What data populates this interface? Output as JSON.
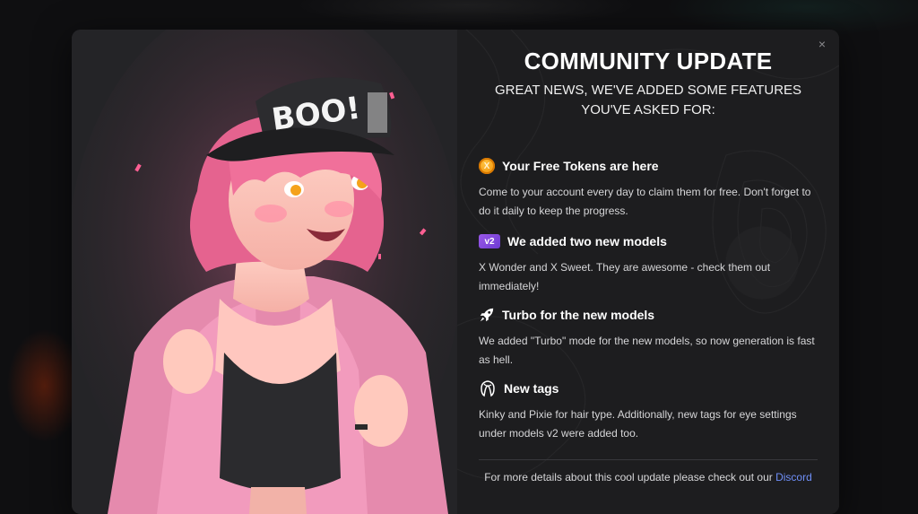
{
  "modal": {
    "title": "COMMUNITY UPDATE",
    "subtitle": "GREAT NEWS, WE'VE ADDED SOME FEATURES YOU'VE ASKED FOR:",
    "close_glyph": "×",
    "art_cap_text": "BOO!"
  },
  "features": [
    {
      "icon": "token-coin-icon",
      "icon_text": "X",
      "title": "Your Free Tokens are here",
      "description": "Come to your account every day to claim them for free. Don't forget to do it daily to keep the progress."
    },
    {
      "icon": "v2-badge-icon",
      "icon_text": "v2",
      "title": "We added two new models",
      "description": "X Wonder and X Sweet. They are awesome - check them out immediately!"
    },
    {
      "icon": "rocket-icon",
      "title": "Turbo for the new models",
      "description": "We added \"Turbo\" mode for the new models, so now generation is fast as hell."
    },
    {
      "icon": "hair-tag-icon",
      "title": "New tags",
      "description": "Kinky and Pixie for hair type. Additionally, new tags for eye settings under models v2 were added too."
    }
  ],
  "footer": {
    "text": "For more details about this cool update please check out our ",
    "link_label": "Discord"
  },
  "colors": {
    "accent_link": "#6f8ff8",
    "hair_pink": "#f0709a",
    "jacket_pink": "#e88aae",
    "coin_orange": "#f5a21b",
    "badge_purple": "#8a4be0"
  }
}
